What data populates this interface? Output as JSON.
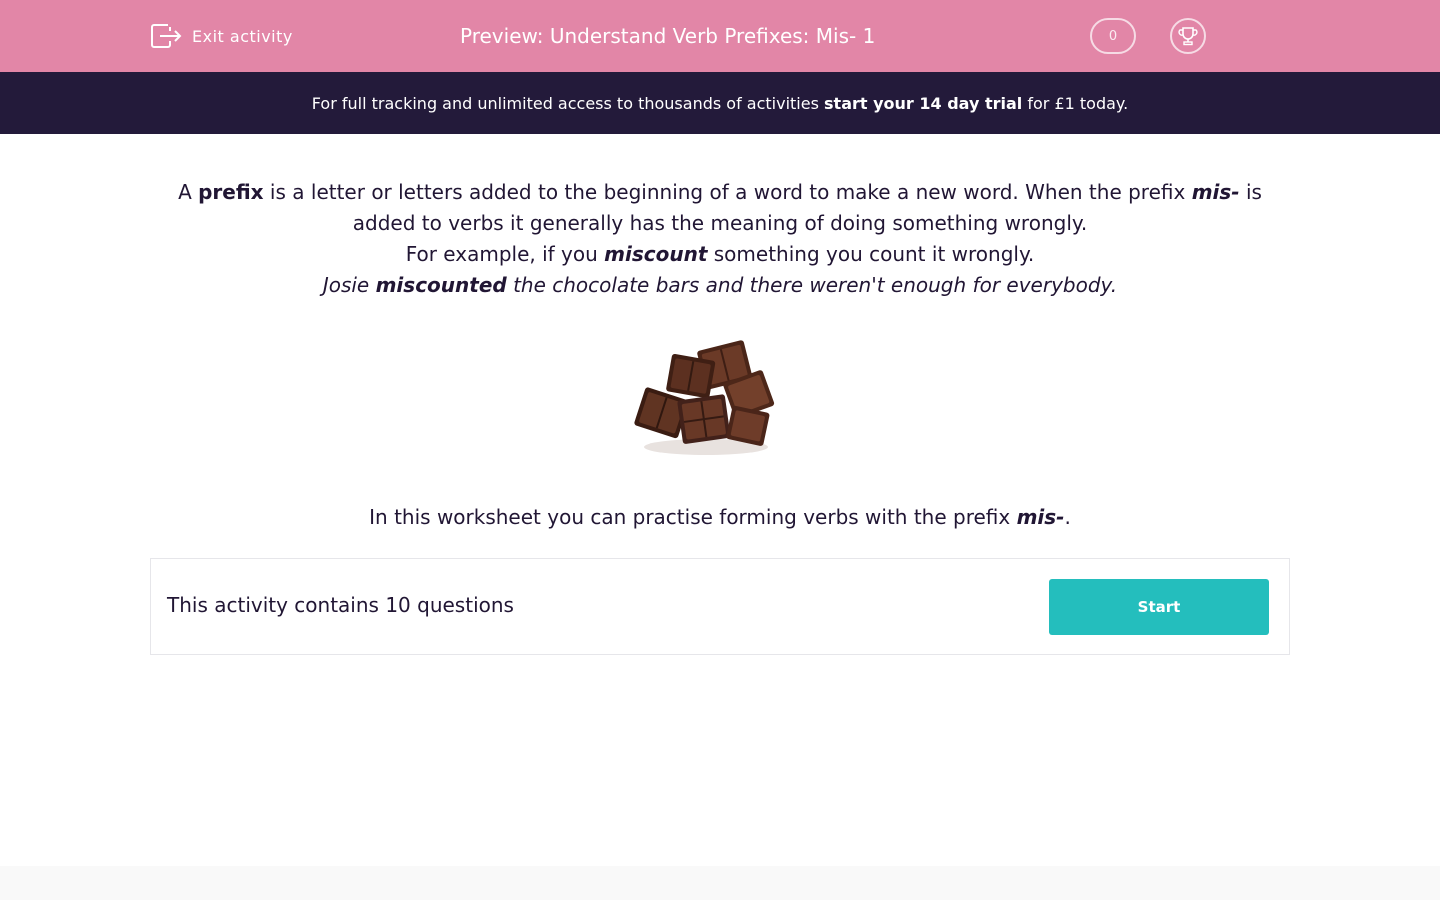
{
  "header": {
    "exit_label": "Exit activity",
    "title": "Preview: Understand Verb Prefixes: Mis- 1",
    "score": "0"
  },
  "banner": {
    "text_before": "For full tracking and unlimited access to thousands of activities ",
    "link_text": "start your 14 day trial",
    "text_after": " for £1 today."
  },
  "intro": {
    "line1_a": "A ",
    "line1_b": "prefix",
    "line1_c": " is a letter or letters added to the beginning of a word to make a new word. When the prefix ",
    "line1_d": "mis-",
    "line1_e": " is added to verbs it generally has the meaning of doing something wrongly.",
    "line2_a": "For example, if you ",
    "line2_b": "miscount",
    "line2_c": " something you count it wrongly.",
    "line3_a": "Josie ",
    "line3_b": "miscounted",
    "line3_c": " the chocolate bars and there weren't enough for everybody."
  },
  "practise": {
    "text": "In this worksheet you can practise forming verbs with the prefix ",
    "prefix": "mis-",
    "end": "."
  },
  "activity": {
    "count_text": "This activity contains 10 questions",
    "start_label": "Start"
  },
  "colors": {
    "header_pink": "#e286a7",
    "banner_dark": "#231a3a",
    "start_teal": "#24bebd",
    "text_dark": "#211634"
  }
}
